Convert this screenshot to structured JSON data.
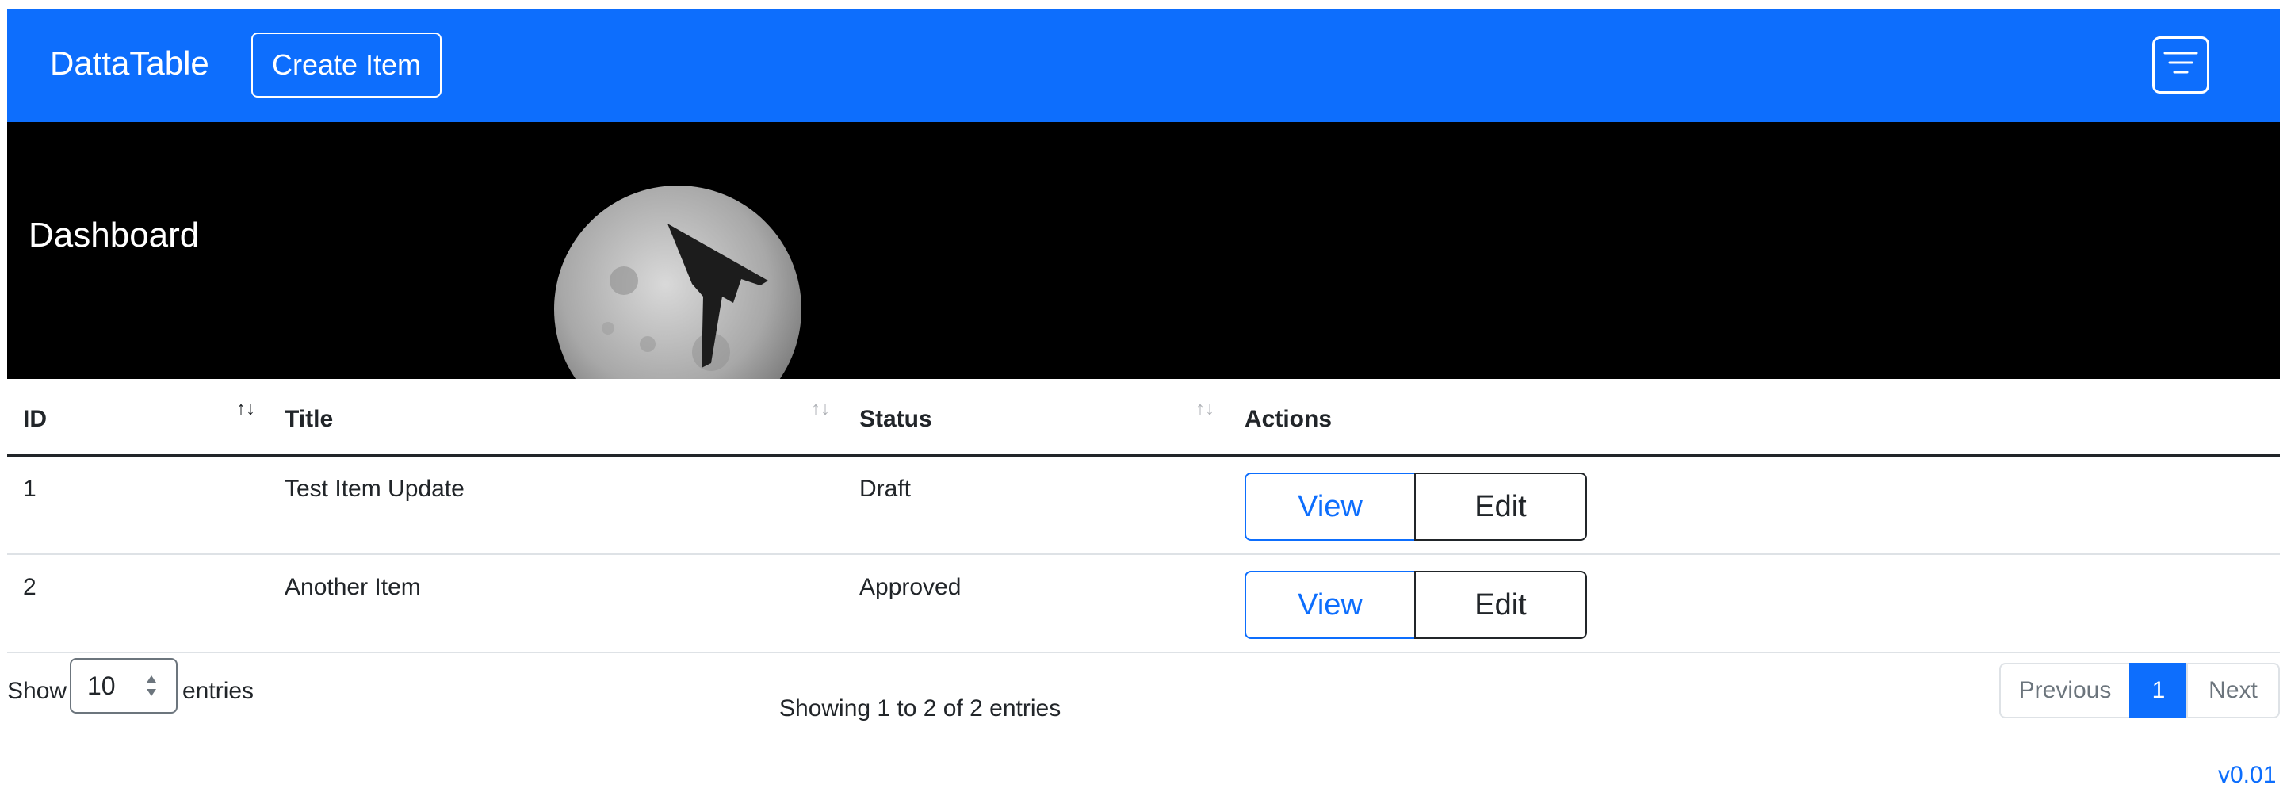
{
  "navbar": {
    "brand": "DattaTable",
    "create_button": "Create Item",
    "menu_icon": "filter-lines-icon",
    "bg_color": "#0d6efd"
  },
  "hero": {
    "title": "Dashboard",
    "image": "moon-with-stealth-bomber"
  },
  "table": {
    "columns": [
      {
        "label": "ID",
        "sort": "active"
      },
      {
        "label": "Title",
        "sort": "inactive"
      },
      {
        "label": "Status",
        "sort": "inactive"
      },
      {
        "label": "Actions"
      }
    ],
    "rows": [
      {
        "id": "1",
        "title": "Test Item Update",
        "status": "Draft",
        "view_label": "View",
        "edit_label": "Edit"
      },
      {
        "id": "2",
        "title": "Another Item",
        "status": "Approved",
        "view_label": "View",
        "edit_label": "Edit"
      }
    ]
  },
  "footer": {
    "show_label": "Show",
    "entries_value": "10",
    "entries_label": "entries",
    "info": "Showing 1 to 2 of 2 entries",
    "pagination": {
      "previous": "Previous",
      "current": "1",
      "next": "Next"
    },
    "version": "v0.01"
  }
}
